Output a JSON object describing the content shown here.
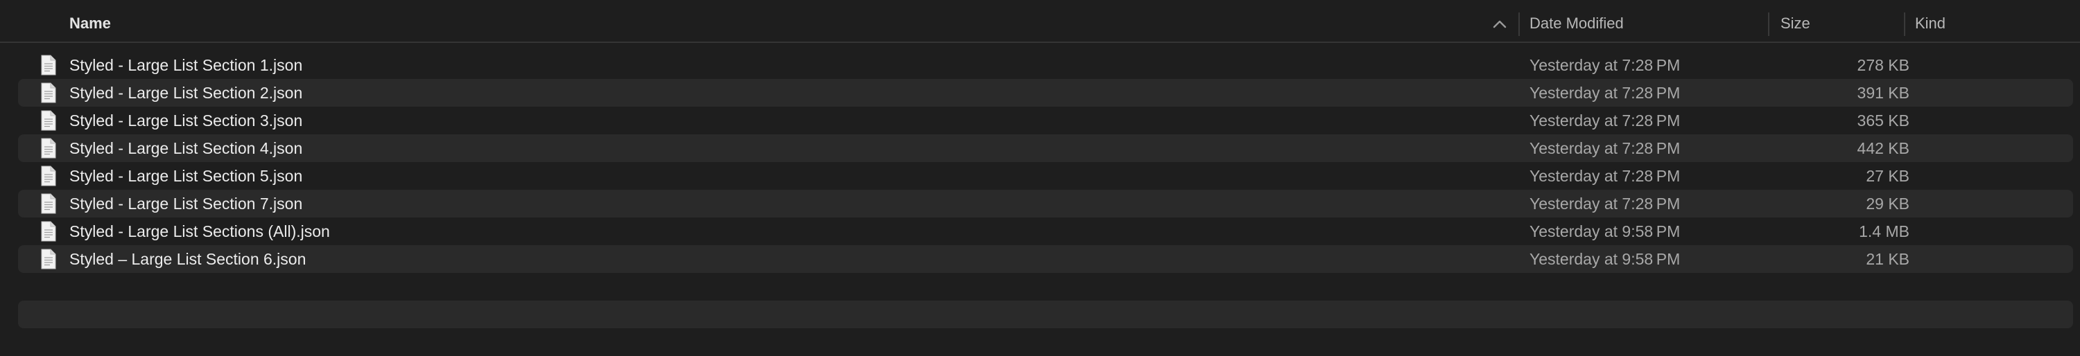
{
  "columns": {
    "name": "Name",
    "date_modified": "Date Modified",
    "size": "Size",
    "kind": "Kind"
  },
  "sort": {
    "column": "Name",
    "direction": "ascending",
    "icon": "chevron-up-icon"
  },
  "files": [
    {
      "name": "Styled - Large List Section 1.json",
      "date": "Yesterday at 7:28 PM",
      "size": "278 KB",
      "icon": "json-document-icon"
    },
    {
      "name": "Styled - Large List Section 2.json",
      "date": "Yesterday at 7:28 PM",
      "size": "391 KB",
      "icon": "json-document-icon"
    },
    {
      "name": "Styled - Large List Section 3.json",
      "date": "Yesterday at 7:28 PM",
      "size": "365 KB",
      "icon": "json-document-icon"
    },
    {
      "name": "Styled - Large List Section 4.json",
      "date": "Yesterday at 7:28 PM",
      "size": "442 KB",
      "icon": "json-document-icon"
    },
    {
      "name": "Styled - Large List Section 5.json",
      "date": "Yesterday at 7:28 PM",
      "size": "27 KB",
      "icon": "json-document-icon"
    },
    {
      "name": "Styled - Large List Section 7.json",
      "date": "Yesterday at 7:28 PM",
      "size": "29 KB",
      "icon": "json-document-icon"
    },
    {
      "name": "Styled - Large List Sections (All).json",
      "date": "Yesterday at 9:58 PM",
      "size": "1.4 MB",
      "icon": "json-document-icon"
    },
    {
      "name": "Styled – Large List Section 6.json",
      "date": "Yesterday at 9:58 PM",
      "size": "21 KB",
      "icon": "json-document-icon"
    }
  ],
  "colors": {
    "background": "#1e1e1e",
    "row_alt": "#2a2a2a",
    "text_primary": "#ececec",
    "text_secondary": "#a8a8a8"
  }
}
